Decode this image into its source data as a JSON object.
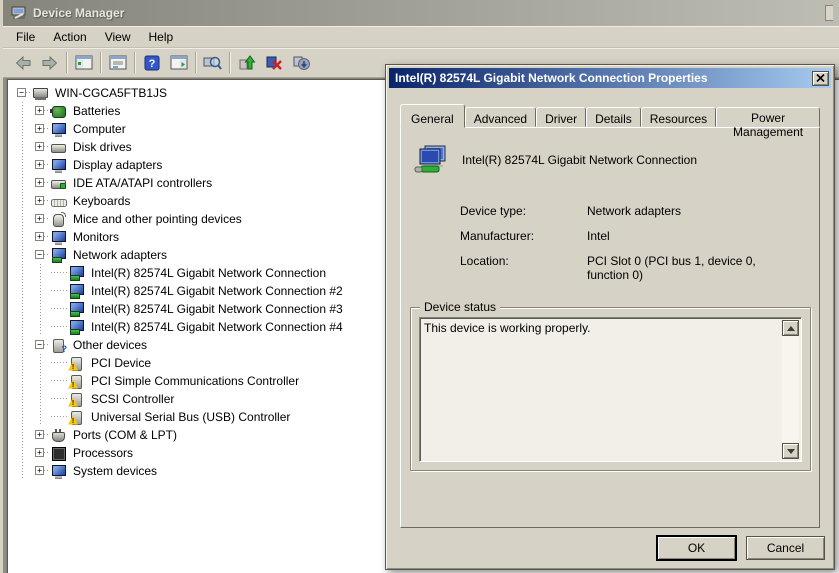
{
  "window": {
    "title": "Device Manager",
    "menu": [
      "File",
      "Action",
      "View",
      "Help"
    ],
    "toolbar_buttons": [
      "back",
      "forward",
      "show-console-tree",
      "properties",
      "help",
      "show-action-pane",
      "scan",
      "update-driver-software",
      "uninstall",
      "scan-for-hardware-changes"
    ]
  },
  "tree": {
    "items": [
      {
        "label": "WIN-CGCA5FTB1JS",
        "level": 0,
        "expand": "minus",
        "icon": "computer-root"
      },
      {
        "label": "Batteries",
        "level": 1,
        "expand": "plus",
        "icon": "battery"
      },
      {
        "label": "Computer",
        "level": 1,
        "expand": "plus",
        "icon": "computer"
      },
      {
        "label": "Disk drives",
        "level": 1,
        "expand": "plus",
        "icon": "disk"
      },
      {
        "label": "Display adapters",
        "level": 1,
        "expand": "plus",
        "icon": "display"
      },
      {
        "label": "IDE ATA/ATAPI controllers",
        "level": 1,
        "expand": "plus",
        "icon": "ide"
      },
      {
        "label": "Keyboards",
        "level": 1,
        "expand": "plus",
        "icon": "keyboard"
      },
      {
        "label": "Mice and other pointing devices",
        "level": 1,
        "expand": "plus",
        "icon": "mouse"
      },
      {
        "label": "Monitors",
        "level": 1,
        "expand": "plus",
        "icon": "monitor"
      },
      {
        "label": "Network adapters",
        "level": 1,
        "expand": "minus",
        "icon": "network"
      },
      {
        "label": "Intel(R) 82574L Gigabit Network Connection",
        "level": 2,
        "expand": "none",
        "icon": "network"
      },
      {
        "label": "Intel(R) 82574L Gigabit Network Connection #2",
        "level": 2,
        "expand": "none",
        "icon": "network"
      },
      {
        "label": "Intel(R) 82574L Gigabit Network Connection #3",
        "level": 2,
        "expand": "none",
        "icon": "network"
      },
      {
        "label": "Intel(R) 82574L Gigabit Network Connection #4",
        "level": 2,
        "expand": "none",
        "icon": "network"
      },
      {
        "label": "Other devices",
        "level": 1,
        "expand": "minus",
        "icon": "other"
      },
      {
        "label": "PCI Device",
        "level": 2,
        "expand": "none",
        "icon": "unknown"
      },
      {
        "label": "PCI Simple Communications Controller",
        "level": 2,
        "expand": "none",
        "icon": "unknown"
      },
      {
        "label": "SCSI Controller",
        "level": 2,
        "expand": "none",
        "icon": "unknown"
      },
      {
        "label": "Universal Serial Bus (USB) Controller",
        "level": 2,
        "expand": "none",
        "icon": "unknown"
      },
      {
        "label": "Ports (COM & LPT)",
        "level": 1,
        "expand": "plus",
        "icon": "ports"
      },
      {
        "label": "Processors",
        "level": 1,
        "expand": "plus",
        "icon": "processor"
      },
      {
        "label": "System devices",
        "level": 1,
        "expand": "plus",
        "icon": "system"
      }
    ]
  },
  "dialog": {
    "title": "Intel(R) 82574L Gigabit Network Connection Properties",
    "close_icon": "close-x-icon",
    "tabs": [
      "General",
      "Advanced",
      "Driver",
      "Details",
      "Resources",
      "Power Management"
    ],
    "selected_tab": "General",
    "device": {
      "icon": "network-adapter-large-icon",
      "name": "Intel(R) 82574L Gigabit Network Connection",
      "fields": [
        {
          "label": "Device type:",
          "value": "Network adapters"
        },
        {
          "label": "Manufacturer:",
          "value": "Intel"
        },
        {
          "label": "Location:",
          "value": "PCI Slot 0 (PCI bus 1, device 0, function 0)"
        }
      ]
    },
    "device_status": {
      "label": "Device status",
      "text": "This device is working properly."
    },
    "buttons": {
      "ok": "OK",
      "cancel": "Cancel"
    }
  },
  "colors": {
    "face": "#d6d2c6",
    "active_caption_start": "#0a246a",
    "active_caption_end": "#a6caf0",
    "inactive_caption_start": "#85857c",
    "inactive_caption_end": "#bdbdb3",
    "tree_background": "#ffffff",
    "warning_yellow": "#f7c80c",
    "network_green": "#2fae3a",
    "device_blue": "#1c3e9c"
  }
}
